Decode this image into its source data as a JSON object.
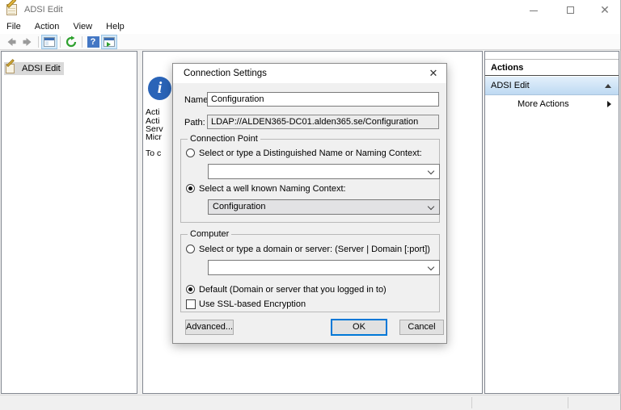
{
  "window": {
    "title": "ADSI Edit"
  },
  "menu": {
    "items": [
      "File",
      "Action",
      "View",
      "Help"
    ]
  },
  "toolbar": {
    "icons": [
      "back-arrow",
      "forward-arrow",
      "console-tree",
      "refresh",
      "help",
      "action-pane-toggle"
    ]
  },
  "tree": {
    "root_label": "ADSI Edit"
  },
  "content": {
    "clipped_lines": [
      "Acti",
      "Acti",
      "Serv",
      "Micr",
      "To c"
    ]
  },
  "actions_pane": {
    "header": "Actions",
    "group_label": "ADSI Edit",
    "more_actions_label": "More Actions"
  },
  "dialog": {
    "title": "Connection Settings",
    "name_label": "Name:",
    "name_value": "Configuration",
    "path_label": "Path:",
    "path_value": "LDAP://ALDEN365-DC01.alden365.se/Configuration",
    "connection_point": {
      "legend": "Connection Point",
      "dn_radio_label": "Select or type a Distinguished Name or Naming Context:",
      "dn_radio_checked": false,
      "dn_value": "",
      "wellknown_radio_label": "Select a well known Naming Context:",
      "wellknown_radio_checked": true,
      "wellknown_value": "Configuration"
    },
    "computer": {
      "legend": "Computer",
      "server_radio_label": "Select or type a domain or server: (Server | Domain [:port])",
      "server_radio_checked": false,
      "server_value": "",
      "default_radio_label": "Default (Domain or server that you logged in to)",
      "default_radio_checked": true,
      "ssl_label": "Use SSL-based Encryption",
      "ssl_checked": false
    },
    "buttons": {
      "advanced": "Advanced...",
      "ok": "OK",
      "cancel": "Cancel"
    }
  },
  "colors": {
    "accent_blue": "#0078d7",
    "actions_bar_top": "#e3f0fb",
    "actions_bar_bottom": "#bed9f2",
    "refresh_green": "#2fa12f",
    "help_blue": "#4477c4",
    "info_blue": "#2a64b8",
    "pane_border": "#828790",
    "dialog_bg": "#f0f0f0"
  }
}
